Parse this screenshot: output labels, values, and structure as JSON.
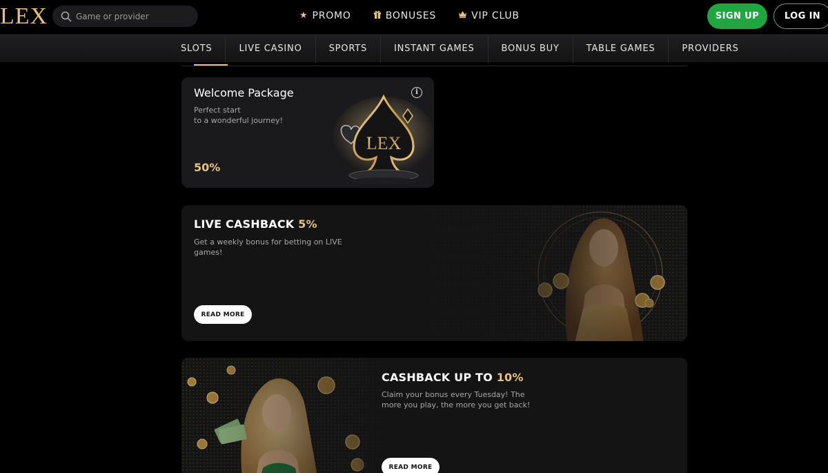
{
  "header": {
    "logo": "LEX",
    "search_placeholder": "Game or provider",
    "nav": [
      {
        "label": "PROMO",
        "icon": "star-icon"
      },
      {
        "label": "BONUSES",
        "icon": "gift-icon"
      },
      {
        "label": "VIP CLUB",
        "icon": "crown-icon"
      }
    ],
    "signup_label": "SIGN UP",
    "login_label": "LOG IN"
  },
  "categories": [
    "SLOTS",
    "LIVE CASINO",
    "SPORTS",
    "INSTANT GAMES",
    "BONUS BUY",
    "TABLE GAMES",
    "PROVIDERS"
  ],
  "welcome": {
    "title": "Welcome Package",
    "desc_line1": "Perfect start",
    "desc_line2": "to a wonderful journey!",
    "percent": "50%",
    "art_text": "LEX"
  },
  "live_cashback": {
    "title": "LIVE CASHBACK",
    "highlight": "5%",
    "desc": "Get a weekly bonus for betting on LIVE games!",
    "button": "READ MORE"
  },
  "cashback": {
    "title": "CASHBACK UP TO",
    "highlight": "10%",
    "desc": "Claim your bonus every Tuesday! The more you play, the more you get back!",
    "button": "READ MORE"
  },
  "colors": {
    "accent_gold": "#e7c27d",
    "signup_green": "#20a640",
    "background": "#000000",
    "card": "#1a1a1c"
  }
}
